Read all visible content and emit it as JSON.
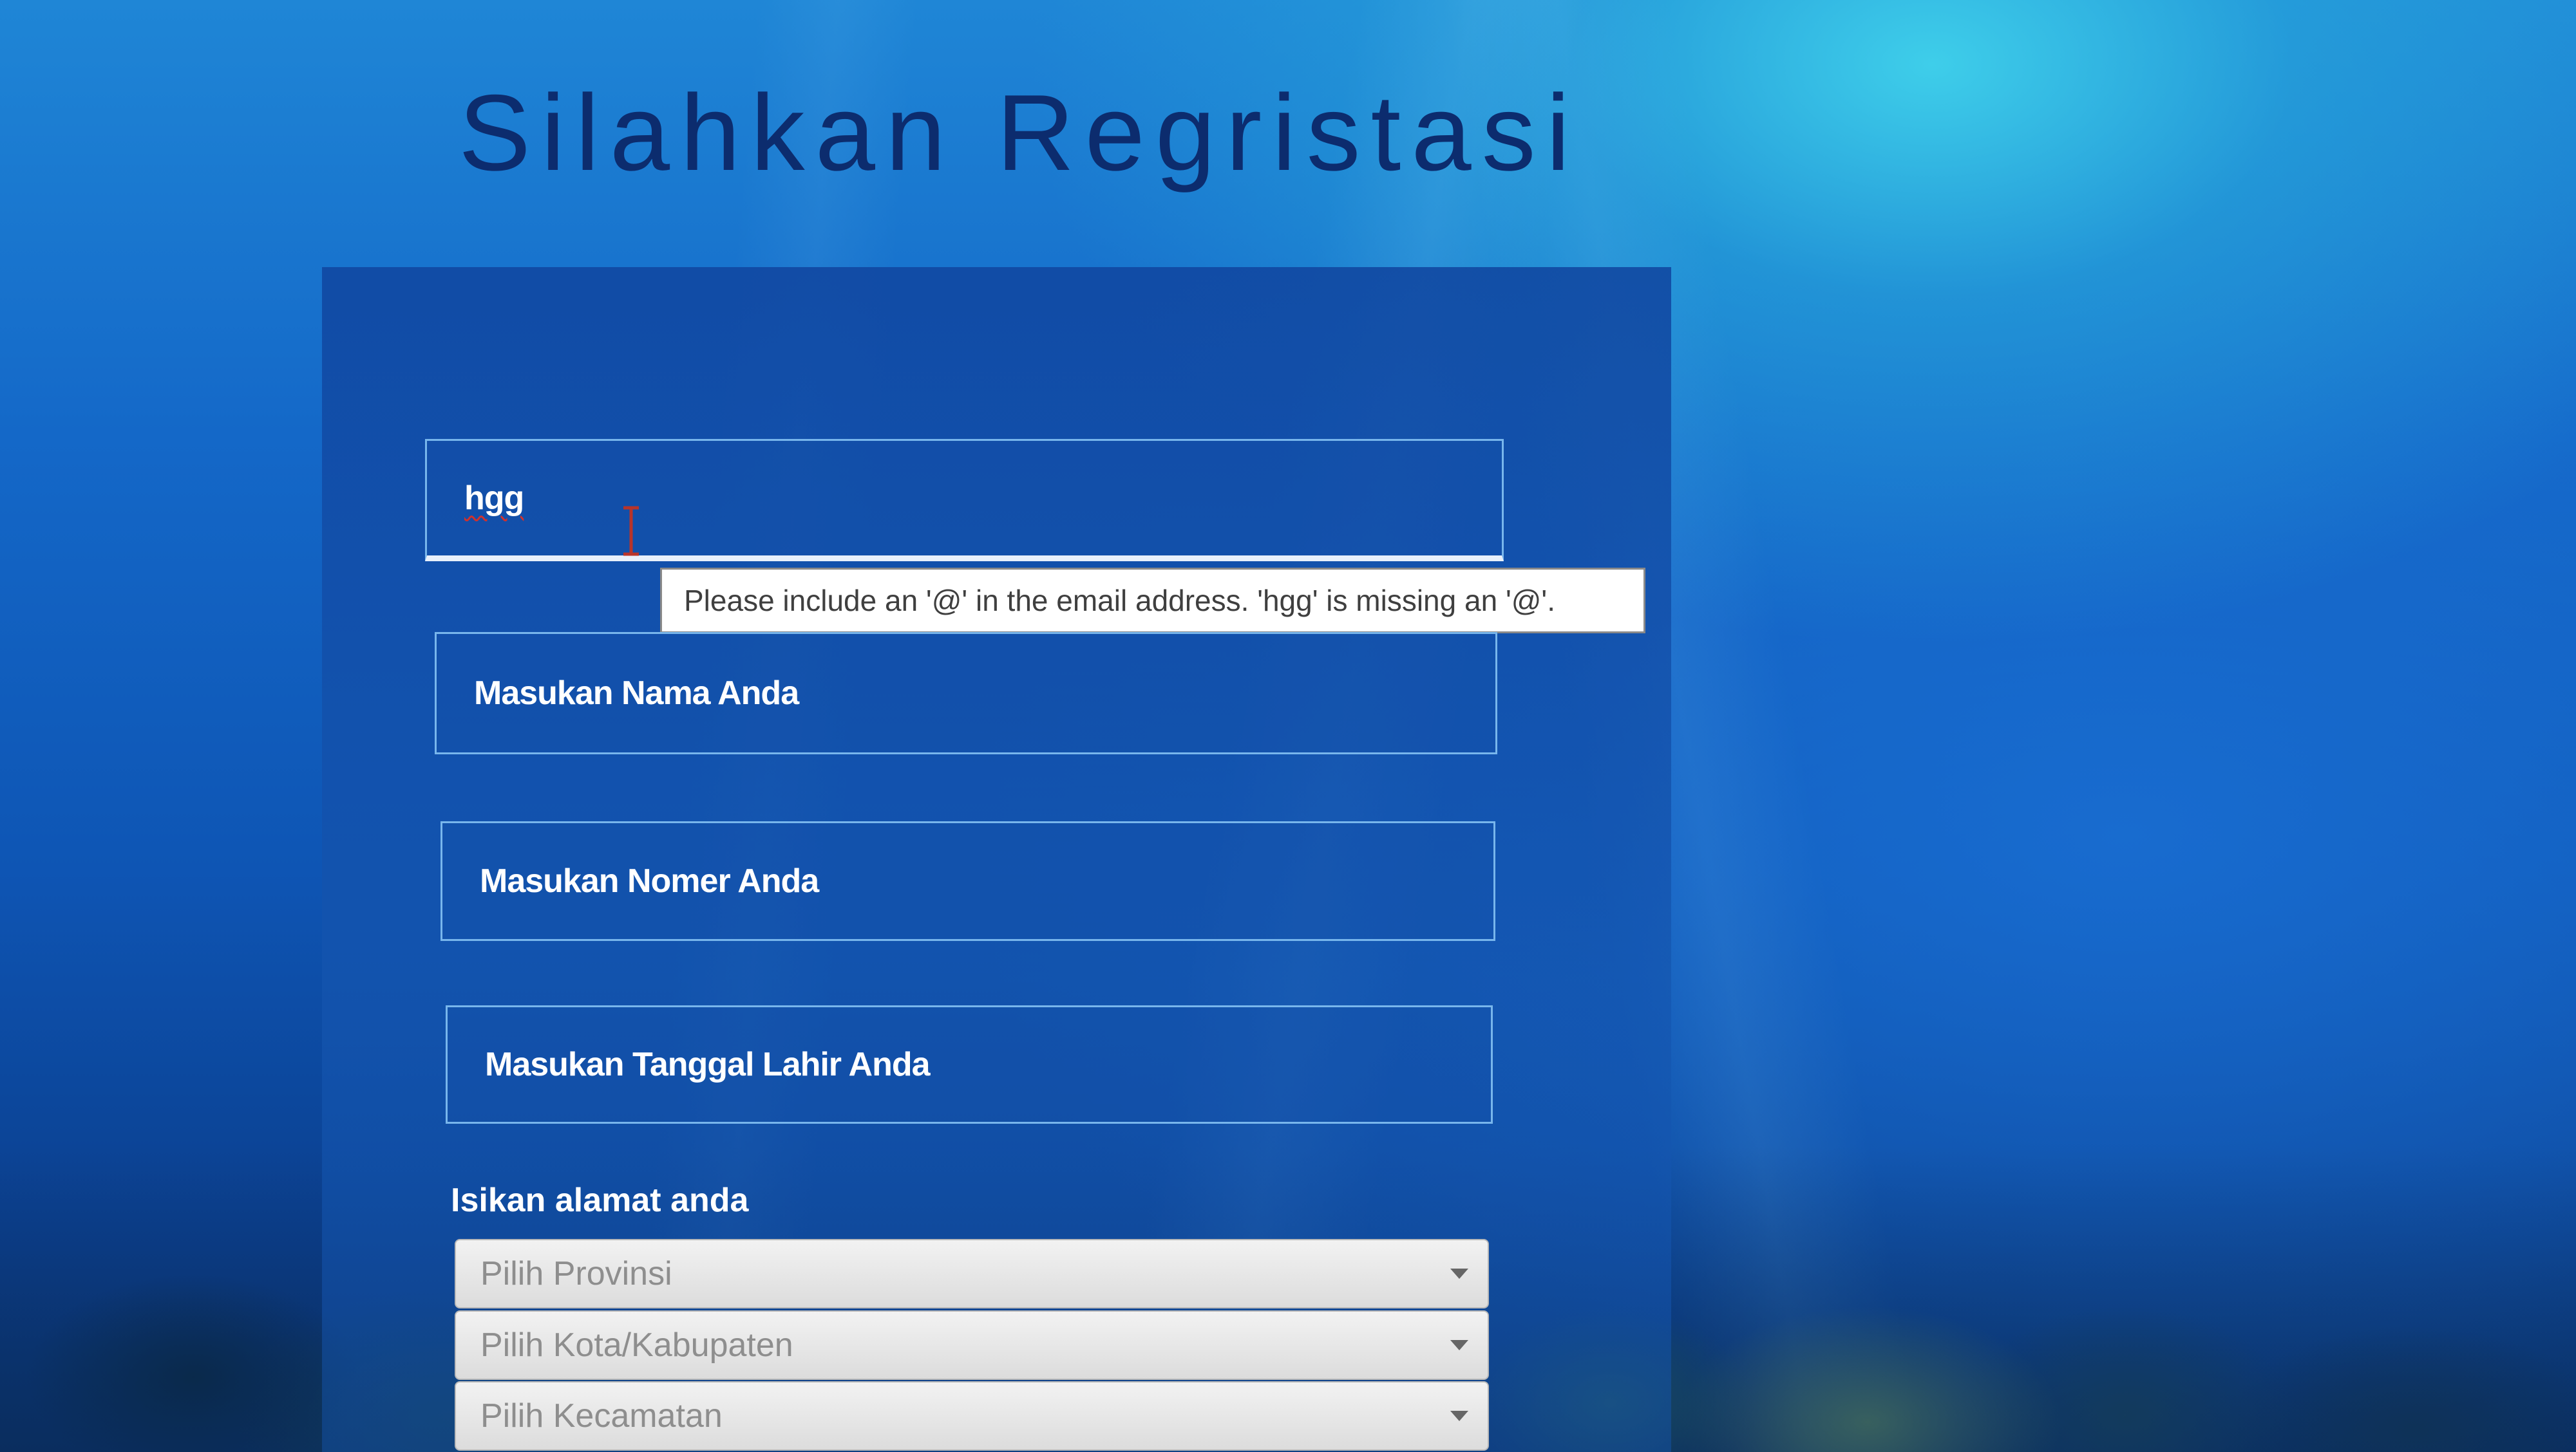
{
  "page": {
    "title": "Silahkan Regristasi"
  },
  "form": {
    "email": {
      "value": "hgg"
    },
    "validation_tooltip": "Please include an '@' in the email address. 'hgg' is missing an '@'.",
    "name_placeholder": "Masukan Nama Anda",
    "phone_placeholder": "Masukan Nomer Anda",
    "birthdate_placeholder": "Masukan Tanggal Lahir Anda",
    "address_label": "Isikan alamat anda",
    "province_select": "Pilih Provinsi",
    "city_select": "Pilih Kota/Kabupaten",
    "district_select": "Pilih Kecamatan"
  },
  "colors": {
    "title": "#0c2c6e",
    "field_border": "#78b6ec",
    "field_text": "#ffffff",
    "select_text": "#8e8e8e"
  },
  "icons": {
    "text_cursor": "i-beam-cursor-icon",
    "dropdown": "chevron-down-icon"
  }
}
